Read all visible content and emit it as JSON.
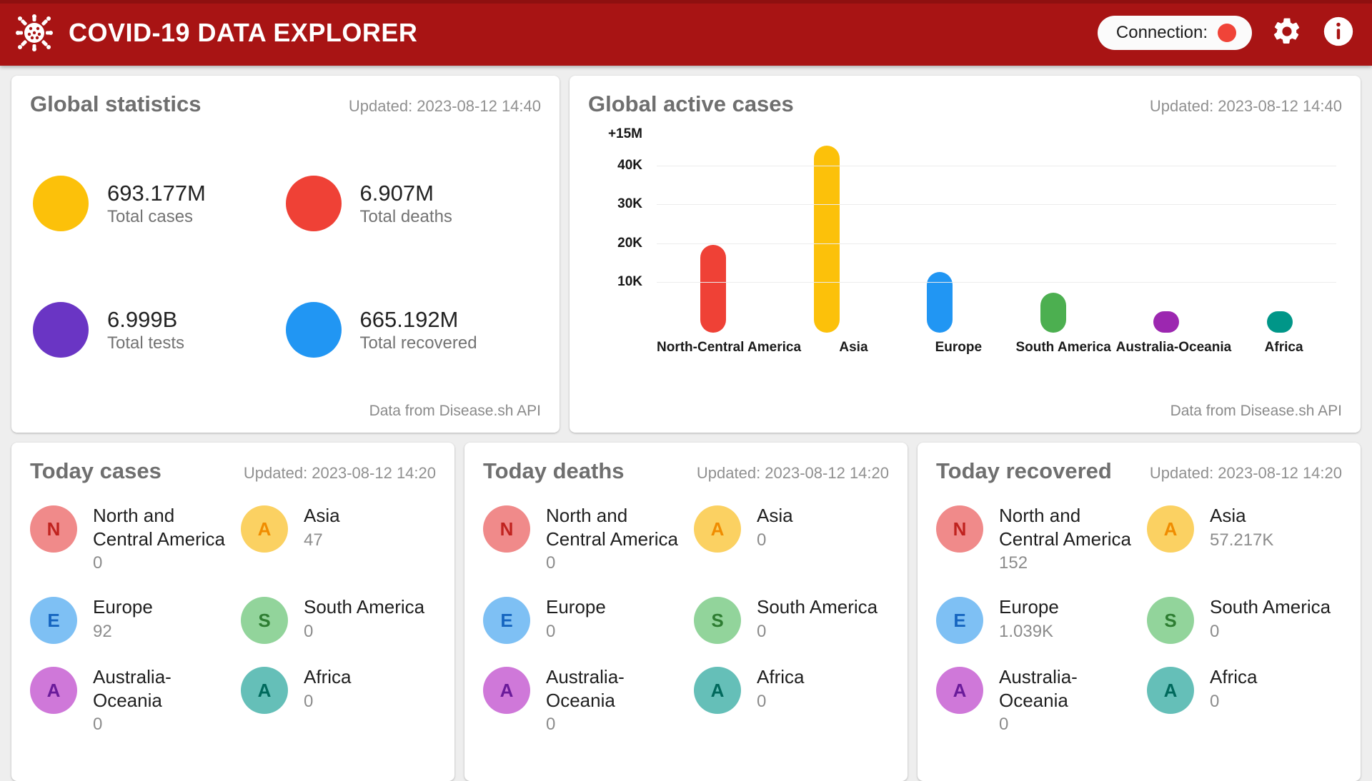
{
  "header": {
    "title": "COVID-19 DATA EXPLORER",
    "logo_icon": "virus-icon",
    "connection_label": "Connection:",
    "connection_status_color": "#f04438",
    "settings_icon": "gear-icon",
    "info_icon": "info-icon",
    "background_color": "#a81414"
  },
  "global_statistics": {
    "title": "Global statistics",
    "updated": "Updated: 2023-08-12 14:40",
    "footer": "Data from Disease.sh API",
    "stats": [
      {
        "value": "693.177M",
        "label": "Total cases",
        "color": "#fcc10a"
      },
      {
        "value": "6.907M",
        "label": "Total deaths",
        "color": "#ef4136"
      },
      {
        "value": "6.999B",
        "label": "Total tests",
        "color": "#6A35C4"
      },
      {
        "value": "665.192M",
        "label": "Total recovered",
        "color": "#2196f3"
      }
    ]
  },
  "global_active_cases": {
    "title": "Global active cases",
    "updated": "Updated: 2023-08-12 14:40",
    "footer": "Data from Disease.sh API",
    "chart_data": {
      "type": "bar",
      "title": "Global active cases",
      "xlabel": "",
      "ylabel": "",
      "ylim": [
        0,
        48000
      ],
      "grid": true,
      "legend": "none",
      "ytick_labels": [
        "+15M",
        "40K",
        "30K",
        "20K",
        "10K"
      ],
      "ytick_values": [
        48000,
        40000,
        30000,
        20000,
        10000
      ],
      "categories": [
        "North-Central America",
        "Asia",
        "Europe",
        "South America",
        "Australia-Oceania",
        "Africa"
      ],
      "values": [
        22500,
        48000,
        15500,
        10200,
        5200,
        5000
      ],
      "colors": [
        "#ef4136",
        "#fcc10a",
        "#2196f3",
        "#4caf50",
        "#9c27b0",
        "#009688"
      ]
    }
  },
  "today_cases": {
    "title": "Today cases",
    "updated": "Updated: 2023-08-12 14:20",
    "regions": [
      {
        "initial": "N",
        "name": "North and Central America",
        "value": "0",
        "bg": "#f08a8a",
        "fg": "#c0231f"
      },
      {
        "initial": "A",
        "name": "Asia",
        "value": "47",
        "bg": "#fbd162",
        "fg": "#f08c00"
      },
      {
        "initial": "E",
        "name": "Europe",
        "value": "92",
        "bg": "#7ec0f4",
        "fg": "#1565c0"
      },
      {
        "initial": "S",
        "name": "South America",
        "value": "0",
        "bg": "#92d49b",
        "fg": "#2e7d32"
      },
      {
        "initial": "A",
        "name": "Australia-Oceania",
        "value": "0",
        "bg": "#cf78d9",
        "fg": "#6a1b9a"
      },
      {
        "initial": "A",
        "name": "Africa",
        "value": "0",
        "bg": "#65bfb8",
        "fg": "#00695c"
      }
    ]
  },
  "today_deaths": {
    "title": "Today deaths",
    "updated": "Updated: 2023-08-12 14:20",
    "regions": [
      {
        "initial": "N",
        "name": "North and Central America",
        "value": "0",
        "bg": "#f08a8a",
        "fg": "#c0231f"
      },
      {
        "initial": "A",
        "name": "Asia",
        "value": "0",
        "bg": "#fbd162",
        "fg": "#f08c00"
      },
      {
        "initial": "E",
        "name": "Europe",
        "value": "0",
        "bg": "#7ec0f4",
        "fg": "#1565c0"
      },
      {
        "initial": "S",
        "name": "South America",
        "value": "0",
        "bg": "#92d49b",
        "fg": "#2e7d32"
      },
      {
        "initial": "A",
        "name": "Australia-Oceania",
        "value": "0",
        "bg": "#cf78d9",
        "fg": "#6a1b9a"
      },
      {
        "initial": "A",
        "name": "Africa",
        "value": "0",
        "bg": "#65bfb8",
        "fg": "#00695c"
      }
    ]
  },
  "today_recovered": {
    "title": "Today recovered",
    "updated": "Updated: 2023-08-12 14:20",
    "regions": [
      {
        "initial": "N",
        "name": "North and Central America",
        "value": "152",
        "bg": "#f08a8a",
        "fg": "#c0231f"
      },
      {
        "initial": "A",
        "name": "Asia",
        "value": "57.217K",
        "bg": "#fbd162",
        "fg": "#f08c00"
      },
      {
        "initial": "E",
        "name": "Europe",
        "value": "1.039K",
        "bg": "#7ec0f4",
        "fg": "#1565c0"
      },
      {
        "initial": "S",
        "name": "South America",
        "value": "0",
        "bg": "#92d49b",
        "fg": "#2e7d32"
      },
      {
        "initial": "A",
        "name": "Australia-Oceania",
        "value": "0",
        "bg": "#cf78d9",
        "fg": "#6a1b9a"
      },
      {
        "initial": "A",
        "name": "Africa",
        "value": "0",
        "bg": "#65bfb8",
        "fg": "#00695c"
      }
    ]
  }
}
